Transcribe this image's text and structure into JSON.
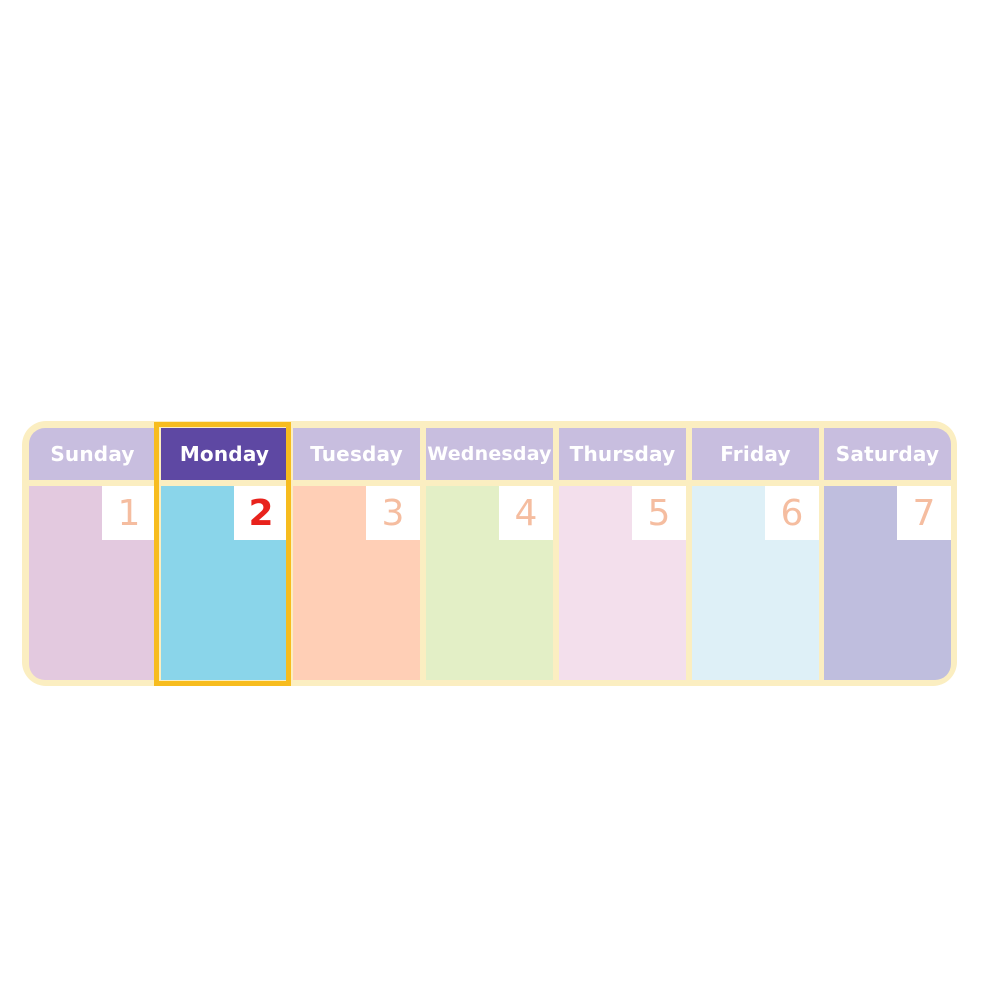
{
  "days": [
    {
      "label": "Sunday",
      "number": "1",
      "color": "#e3c9df"
    },
    {
      "label": "Monday",
      "number": "2",
      "color": "#8ad5ea"
    },
    {
      "label": "Tuesday",
      "number": "3",
      "color": "#ffcfb6"
    },
    {
      "label": "Wednesday",
      "number": "4",
      "color": "#e3efc6"
    },
    {
      "label": "Thursday",
      "number": "5",
      "color": "#f3dfec"
    },
    {
      "label": "Friday",
      "number": "6",
      "color": "#def0f7"
    },
    {
      "label": "Saturday",
      "number": "7",
      "color": "#bfbede"
    }
  ],
  "selected_day": "Monday",
  "colors": {
    "frame": "#fbeec1",
    "header": "#c8bedf",
    "selected_header": "#5e48a3",
    "highlight_border": "#f7bc1e",
    "number": "#f5bda0",
    "selected_number": "#e8221c"
  }
}
